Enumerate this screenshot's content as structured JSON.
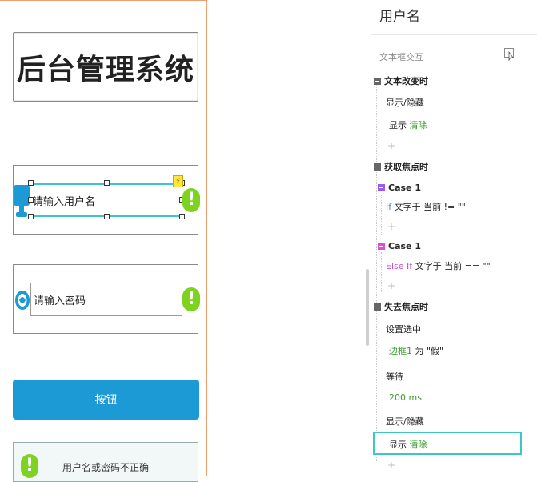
{
  "canvas": {
    "title": "后台管理系统",
    "username_placeholder": "请输入用户名",
    "password_placeholder": "请输入密码",
    "button_label": "按钮",
    "error_message": "用户名或密码不正确",
    "check_mark": "!",
    "bolt_mark": "⚡"
  },
  "panel": {
    "title": "用户名",
    "section_label": "文本框交互",
    "plus": "+",
    "event_text_change": "文本改变时",
    "action_show_hide_1": "显示/隐藏",
    "action_show_1_verb": "显示",
    "action_show_1_target": "清除",
    "event_focus": "获取焦点时",
    "case1_label": "Case 1",
    "case1_if": "If",
    "case1_cond": "文字于 当前 != \"\"",
    "case2_label": "Case 1",
    "case2_if": "Else If",
    "case2_cond": "文字于 当前 == \"\"",
    "event_blur": "失去焦点时",
    "action_set_selected": "设置选中",
    "set_selected_target": "边框1",
    "set_selected_value": "为 \"假\"",
    "action_wait": "等待",
    "wait_value": "200 ms",
    "action_show_hide_2": "显示/隐藏",
    "action_show_2_verb": "显示",
    "action_show_2_target": "清除"
  },
  "colors": {
    "accent_teal": "#3cc6c8",
    "button_blue": "#1b9ad6",
    "check_green": "#7ed321",
    "action_green": "#3a9a2e",
    "else_pink": "#c94fc9"
  }
}
